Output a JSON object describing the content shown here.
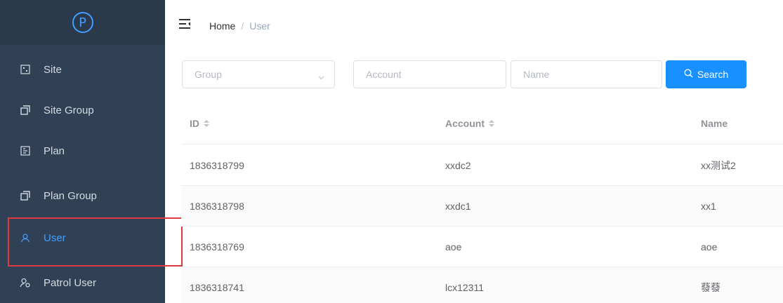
{
  "logo": {
    "glyph": "P"
  },
  "sidebar": {
    "items": [
      {
        "label": "Site",
        "icon": "site-icon"
      },
      {
        "label": "Site Group",
        "icon": "copy-icon"
      },
      {
        "label": "Plan",
        "icon": "plan-icon"
      },
      {
        "label": "Plan Group",
        "icon": "copy-icon"
      },
      {
        "label": "User",
        "icon": "user-icon",
        "active": true
      },
      {
        "label": "Patrol User",
        "icon": "patrol-user-icon"
      }
    ]
  },
  "header": {
    "toggle_icon": "menu-fold-icon",
    "breadcrumb": {
      "home": "Home",
      "separator": "/",
      "current": "User"
    }
  },
  "filters": {
    "group_placeholder": "Group",
    "account_placeholder": "Account",
    "name_placeholder": "Name",
    "search_label": "Search"
  },
  "table": {
    "columns": [
      "ID",
      "Account",
      "Name"
    ],
    "rows": [
      [
        "1836318799",
        "xxdc2",
        "xx测试2"
      ],
      [
        "1836318798",
        "xxdc1",
        "xx1"
      ],
      [
        "1836318769",
        "aoe",
        "aoe"
      ],
      [
        "1836318741",
        "lcx12311",
        "蕟蕟"
      ]
    ]
  },
  "colors": {
    "sidebar_bg": "#304156",
    "logo_bg": "#2b3a4b",
    "accent": "#409eff",
    "button": "#1890ff",
    "highlight_box": "#e0393e"
  }
}
